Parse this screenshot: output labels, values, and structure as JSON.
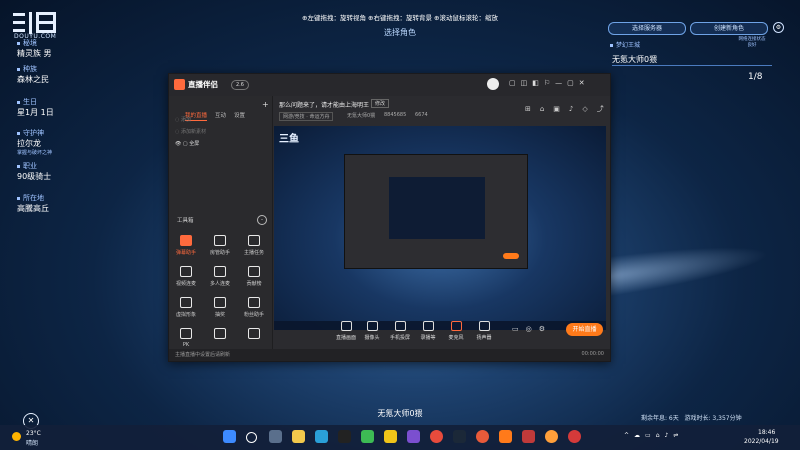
{
  "brand": {
    "site_url": "DOUYU.COM"
  },
  "left_panel": [
    {
      "label": "秘境",
      "value": "精灵族 男"
    },
    {
      "label": "种族",
      "value": "森林之民"
    },
    {
      "label": "生日",
      "value": "星1月 1日"
    },
    {
      "label": "守护神",
      "value": "拉尔龙",
      "sub": "掌握与破坏之神"
    },
    {
      "label": "职业",
      "value": "90级骑士"
    },
    {
      "label": "所在地",
      "value": "高騰高丘"
    }
  ],
  "top_banner": {
    "text": "⊕左键拖拽：旋转视角 ⊕右键拖拽：旋转背景 ⊕滚动鼠标滚轮：缩放",
    "subtitle": "选择角色"
  },
  "right_panel": {
    "btn1": "选择服务器",
    "btn2": "创建新角色",
    "small_label": "梦幻王城",
    "right_small": "网络连接状态 良好",
    "char_name": "无氪大师0猥",
    "page": "1/8"
  },
  "app_window": {
    "title": "直播伴侣",
    "version": "2.6",
    "tabs": [
      "我的直播",
      "互动",
      "设置"
    ],
    "sources": [
      "添加",
      "添加新素材",
      "全屏"
    ],
    "toolbox_title": "工具箱",
    "tools": [
      "弹幕助手",
      "房管助手",
      "主播任务",
      "视频连麦",
      "多人连麦",
      "贡献榜",
      "虚拟形象",
      "抽奖",
      "粉丝助手",
      "PK",
      "",
      ""
    ],
    "stream_title": "那么问题来了，请才能由上海明王",
    "stream_title_tag": "修改",
    "category": "网游/竞技 · 命运方舟",
    "room_info": "无氪大师0猥",
    "fans": "8845685",
    "hot": "6674",
    "controls": [
      "直播画面",
      "摄像头",
      "手机投屏",
      "录播等",
      "麦克风",
      "扬声器"
    ],
    "go_live": "开始直播",
    "status_left": "主播直播中设置后请刷新",
    "status_right": "00:00:00"
  },
  "bottom_text": "无氪大师0猥",
  "stats": {
    "days": "剩余年息: 6天",
    "time": "游戏时长: 3,357分钟"
  },
  "weather": {
    "temp": "23°C",
    "desc": "晴朗"
  },
  "clock": {
    "time": "18:46",
    "date": "2022/04/19"
  }
}
